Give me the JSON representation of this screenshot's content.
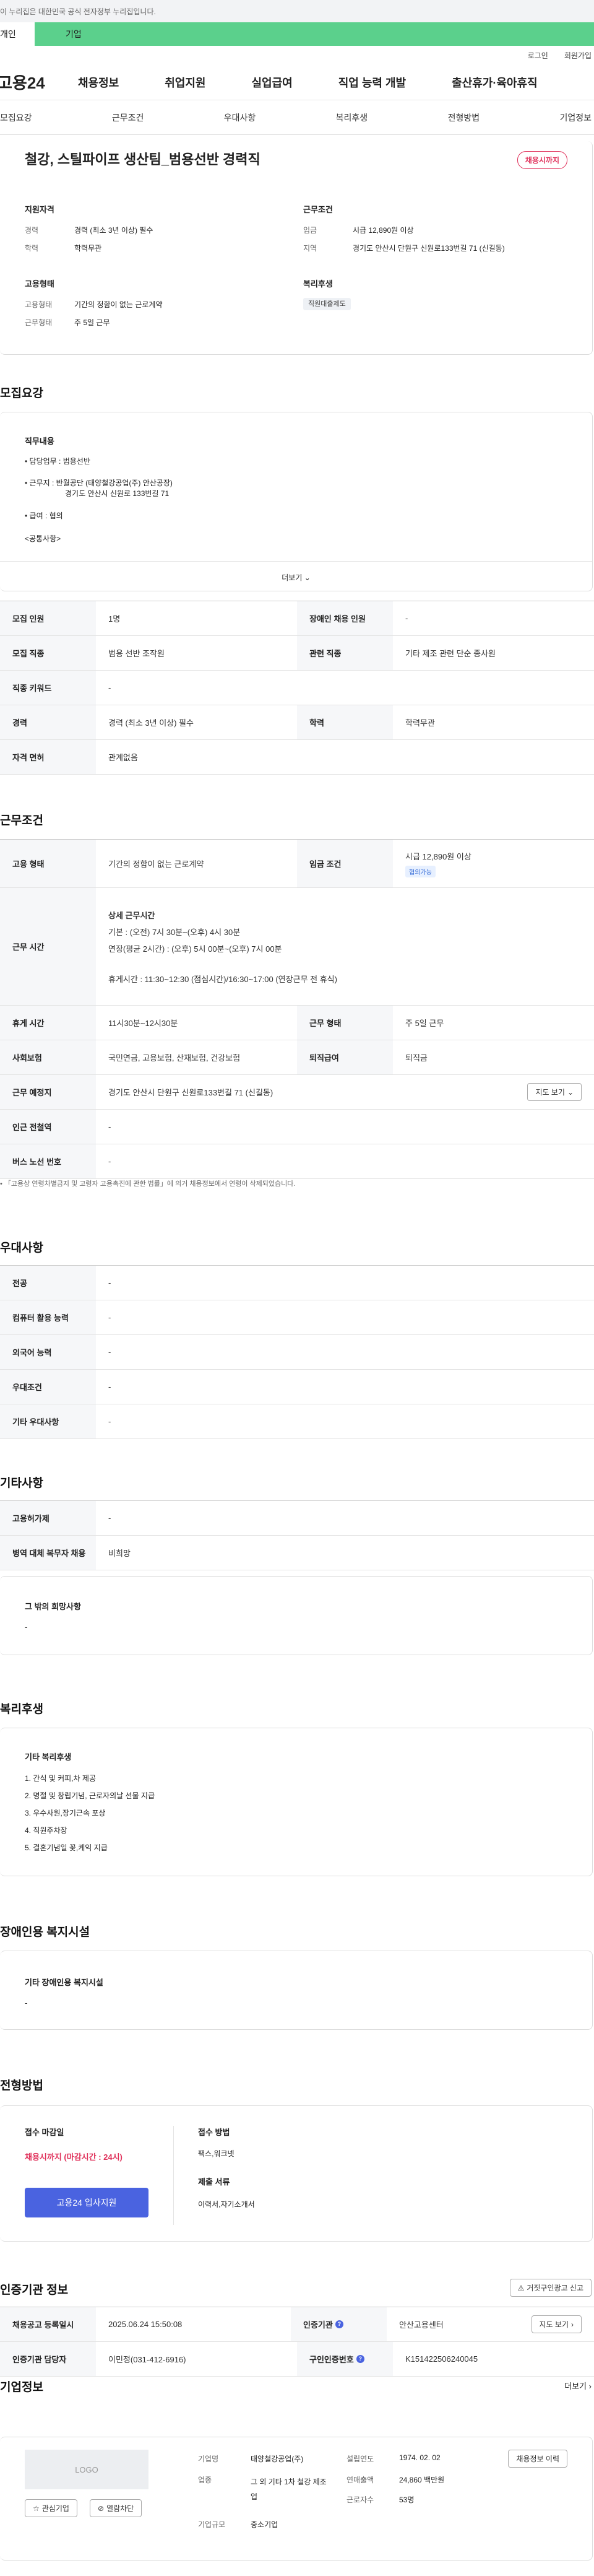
{
  "gov_notice": "이 누리집은 대한민국 공식 전자정부 누리집입니다.",
  "service_bar": {
    "personal": "개인",
    "company": "기업"
  },
  "util_links": [
    "로그인",
    "회원가입"
  ],
  "gnb": {
    "logo": "고용24",
    "menu": [
      "채용정보",
      "취업지원",
      "실업급여",
      "직업 능력 개발",
      "출산휴가·육아휴직"
    ]
  },
  "tabs": [
    "모집요강",
    "근무조건",
    "우대사항",
    "복리후생",
    "전형방법",
    "기업정보"
  ],
  "summary": {
    "title": "철강, 스틸파이프 생산팀_범용선반 경력직",
    "badge": "채용시까지",
    "qualification": {
      "heading": "지원자격",
      "rows": [
        {
          "k": "경력",
          "v": "경력 (최소 3년 이상) 필수"
        },
        {
          "k": "학력",
          "v": "학력무관"
        }
      ]
    },
    "work": {
      "heading": "근무조건",
      "rows": [
        {
          "k": "임금",
          "v": "시급 12,890원 이상"
        },
        {
          "k": "지역",
          "v": "경기도 안산시 단원구 신원로133번길 71 (신길동)"
        }
      ]
    },
    "employ": {
      "heading": "고용형태",
      "rows": [
        {
          "k": "고용형태",
          "v": "기간의 정함이 없는 근로계약"
        },
        {
          "k": "근무형태",
          "v": "주 5일 근무"
        }
      ]
    },
    "welfare": {
      "heading": "복리후생",
      "tag": "직원대출제도"
    }
  },
  "recruit": {
    "title": "모집요강",
    "duty_heading": "직무내용",
    "lines": [
      "• 담당업무 : 범용선반",
      "• 근무지 : 반월공단 (태양철강공업(주) 안산공장)",
      "경기도 안산시 신원로 133번길 71",
      "• 급여 : 협의",
      "<공통사항>"
    ],
    "more": "더보기",
    "table": [
      [
        {
          "k": "모집 인원",
          "v": "1명"
        },
        {
          "k": "장애인 채용 인원",
          "v": "-"
        }
      ],
      [
        {
          "k": "모집 직종",
          "v": "범용 선반 조작원"
        },
        {
          "k": "관련 직종",
          "v": "기타 제조 관련 단순 종사원"
        }
      ],
      [
        {
          "k": "직종 키워드",
          "v": "-"
        }
      ],
      [
        {
          "k": "경력",
          "v": "경력 (최소 3년 이상) 필수"
        },
        {
          "k": "학력",
          "v": "학력무관"
        }
      ],
      [
        {
          "k": "자격 면허",
          "v": "관계없음"
        }
      ]
    ]
  },
  "conditions": {
    "title": "근무조건",
    "employ_type": {
      "k": "고용 형태",
      "v": "기간의 정함이 없는 근로계약"
    },
    "wage": {
      "k": "임금 조건",
      "v": "시급 12,890원 이상",
      "tag": "협의가능"
    },
    "hours": {
      "k": "근무 시간",
      "heading": "상세 근무시간",
      "lines": [
        "기본 : (오전) 7시 30분~(오후) 4시 30분",
        "연장(평균 2시간) : (오후) 5시 00분~(오후) 7시 00분",
        "휴게시간 : 11:30~12:30 (점심시간)/16:30~17:00 (연장근무 전 휴식)"
      ]
    },
    "break": {
      "k": "휴게 시간",
      "v": "11시30분~12시30분"
    },
    "work_form": {
      "k": "근무 형태",
      "v": "주 5일 근무"
    },
    "insurance": {
      "k": "사회보험",
      "v": "국민연금, 고용보험, 산재보험, 건강보험"
    },
    "retire": {
      "k": "퇴직급여",
      "v": "퇴직금"
    },
    "location": {
      "k": "근무 예정지",
      "v": "경기도 안산시 단원구 신원로133번길 71 (신길동)",
      "btn": "지도 보기"
    },
    "subway": {
      "k": "인근 전철역",
      "v": "-"
    },
    "bus": {
      "k": "버스 노선 번호",
      "v": "-"
    },
    "notice": "「고용상 연령차별금지 및 고령자 고용촉진에 관한 법률」에 의거 채용정보에서 연령이 삭제되었습니다."
  },
  "preference": {
    "title": "우대사항",
    "rows": [
      {
        "k": "전공",
        "v": "-"
      },
      {
        "k": "컴퓨터 활용 능력",
        "v": "-"
      },
      {
        "k": "외국어 능력",
        "v": "-"
      },
      {
        "k": "우대조건",
        "v": "-"
      },
      {
        "k": "기타 우대사항",
        "v": "-"
      }
    ]
  },
  "etc": {
    "title": "기타사항",
    "rows": [
      {
        "k": "고용허가제",
        "v": "-"
      },
      {
        "k": "병역 대체 복무자 채용",
        "v": "비희망"
      }
    ],
    "other_heading": "그 밖의 희망사항",
    "other_value": "-"
  },
  "benefits": {
    "title": "복리후생",
    "heading": "기타 복리후생",
    "items": [
      "1. 간식 및 커피,차 제공",
      "2. 명절 및 창립기념, 근로자의날 선물 지급",
      "3. 우수사원,장기근속 포상",
      "4. 직원주차장",
      "5. 결혼기념일 꽃,케익 지급"
    ]
  },
  "disability": {
    "title": "장애인용 복지시설",
    "heading": "기타 장애인용 복지시설",
    "value": "-"
  },
  "selection": {
    "title": "전형방법",
    "deadline_heading": "접수 마감일",
    "deadline_value": "채용시까지 (마감시간 : 24시)",
    "apply_btn": "고용24 입사지원",
    "method_heading": "접수 방법",
    "method_value": "팩스,워크넷",
    "docs_heading": "제출 서류",
    "docs_value": "이력서,자기소개서"
  },
  "cert": {
    "title": "인증기관 정보",
    "report_btn": "거짓구인광고 신고",
    "rows": [
      [
        {
          "k": "채용공고 등록일시",
          "v": "2025.06.24 15:50:08"
        },
        {
          "k": "인증기관",
          "v": "안산고용센터",
          "btn": "지도 보기"
        }
      ],
      [
        {
          "k": "인증기관 담당자",
          "v": "이민정(031-412-6916)"
        },
        {
          "k": "구인인증번호",
          "v": "K151422506240045"
        }
      ]
    ]
  },
  "company": {
    "title": "기업정보",
    "more": "더보기",
    "logo": "LOGO",
    "interest_btn": "관심기업",
    "block_btn": "열람차단",
    "name_k": "기업명",
    "name_v": "태양철강공업(주)",
    "industry_k": "업종",
    "industry_v": "그 외 기타 1차 철강 제조업",
    "size_k": "기업규모",
    "size_v": "중소기업",
    "founded_k": "설립연도",
    "founded_v": "1974. 02. 02",
    "sales_k": "연매출액",
    "sales_v": "24,860 백만원",
    "staff_k": "근로자수",
    "staff_v": "53명",
    "jobs_btn": "채용정보 이력"
  }
}
